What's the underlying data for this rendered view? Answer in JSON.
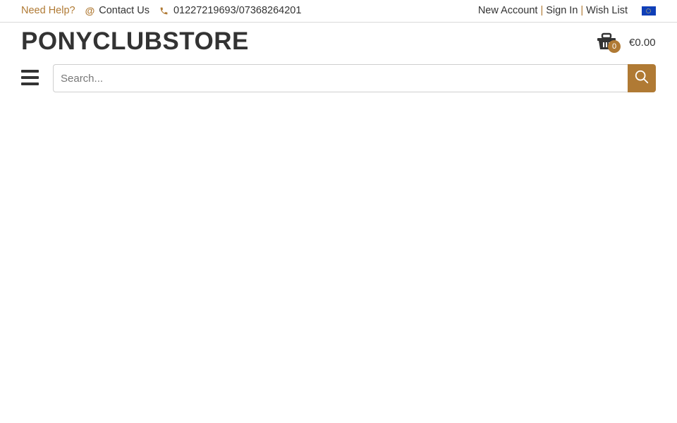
{
  "topbar": {
    "help_text": "Need Help?",
    "contact_label": "Contact Us",
    "contact_icon": "at-icon",
    "phone_icon": "phone-icon",
    "phone_number": "01227219693/07368264201",
    "links": {
      "new_account": "New Account",
      "sign_in": "Sign In",
      "wish_list": "Wish List"
    },
    "separator": "|",
    "flag_icon": "eu-flag-icon"
  },
  "header": {
    "logo": "PONYCLUBSTORE",
    "cart": {
      "count": "0",
      "total": "€0.00",
      "icon": "basket-icon"
    }
  },
  "search": {
    "placeholder": "Search...",
    "value": "",
    "button_icon": "search-icon"
  },
  "colors": {
    "accent": "#b07a34",
    "text": "#333333",
    "border": "#d9d9d9"
  }
}
